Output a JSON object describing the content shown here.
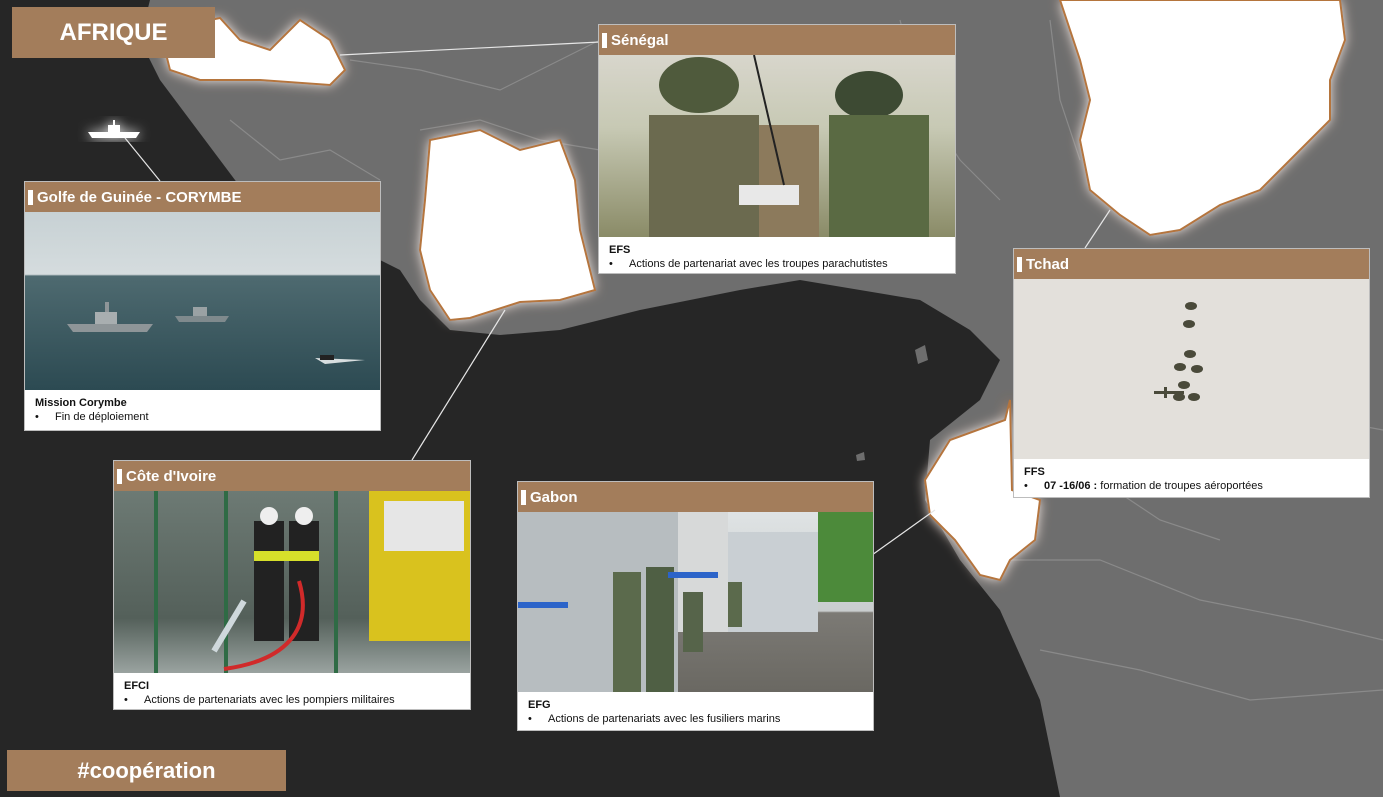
{
  "region_title": "AFRIQUE",
  "hashtag": "#coopération",
  "cards": {
    "guinee": {
      "title": "Golfe de Guinée - CORYMBE",
      "heading": "Mission Corymbe",
      "bullet": "Fin de déploiement"
    },
    "senegal": {
      "title": "Sénégal",
      "heading": "EFS",
      "bullet": "Actions de partenariat avec les troupes parachutistes"
    },
    "tchad": {
      "title": "Tchad",
      "heading": "FFS",
      "bullet_bold": "07 -16/06 :",
      "bullet": "formation de troupes aéroportées"
    },
    "cote_ivoire": {
      "title": "Côte d'Ivoire",
      "heading": "EFCI",
      "bullet": "Actions de partenariats avec les pompiers militaires"
    },
    "gabon": {
      "title": "Gabon",
      "heading": "EFG",
      "bullet": "Actions de partenariats avec les fusiliers marins"
    }
  },
  "bullet_symbol": "•",
  "colors": {
    "background": "#262626",
    "land": "#6e6e6e",
    "highlight_country": "#ffffff",
    "glow": "#b5743d",
    "accent": "#a37d5b"
  }
}
